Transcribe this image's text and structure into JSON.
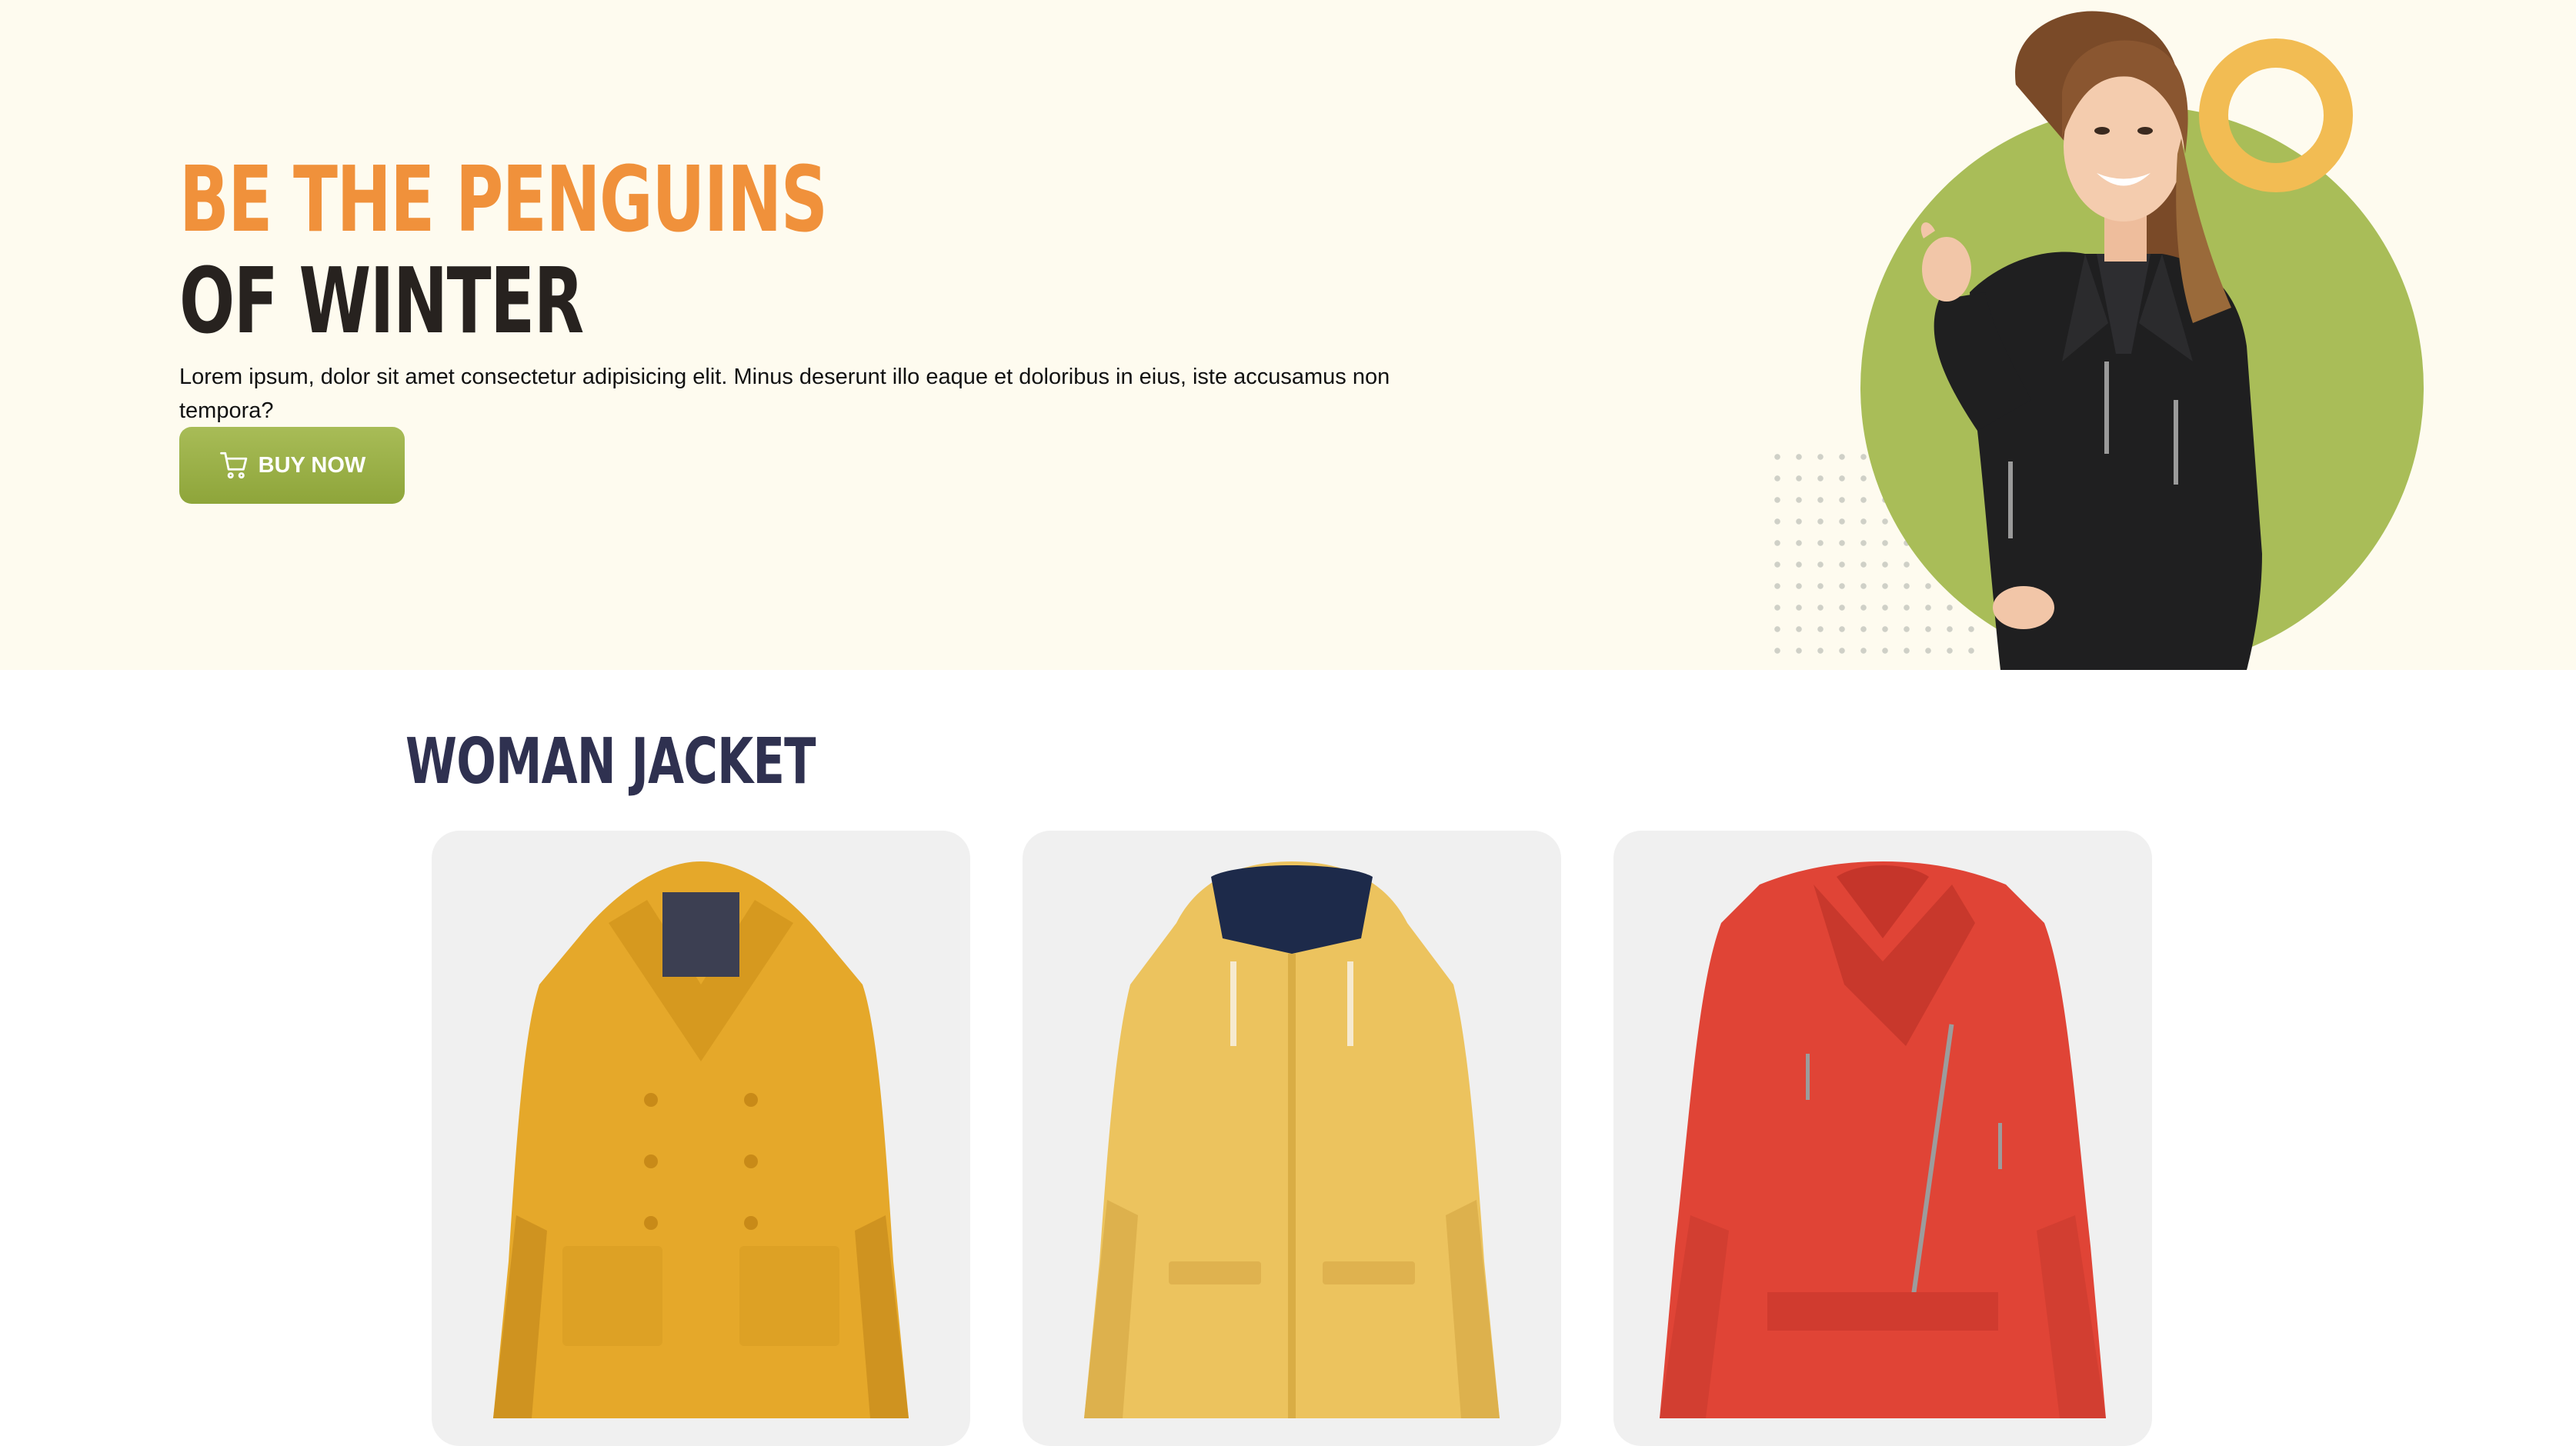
{
  "hero": {
    "title_line1": "BE THE PENGUINS",
    "title_line2": "OF WINTER",
    "description": "Lorem ipsum, dolor sit amet consectetur adipisicing elit. Minus deserunt illo eaque et doloribus in eius, iste accusamus non tempora?",
    "buy_button_label": "BUY NOW",
    "buy_button_icon": "cart-icon"
  },
  "colors": {
    "hero_background": "#fefbef",
    "accent_orange": "#f0913b",
    "accent_green": "#a9bd58",
    "accent_yellow_ring": "#f2bc53",
    "title_dark": "#27221f",
    "section_title": "#2f3150",
    "card_background": "#f0f0f0"
  },
  "products_section": {
    "title": "WOMAN JACKET",
    "products": [
      {
        "image": "yellow-wool-coat"
      },
      {
        "image": "yellow-hooded-raincoat"
      },
      {
        "image": "red-leather-biker-jacket"
      }
    ]
  }
}
